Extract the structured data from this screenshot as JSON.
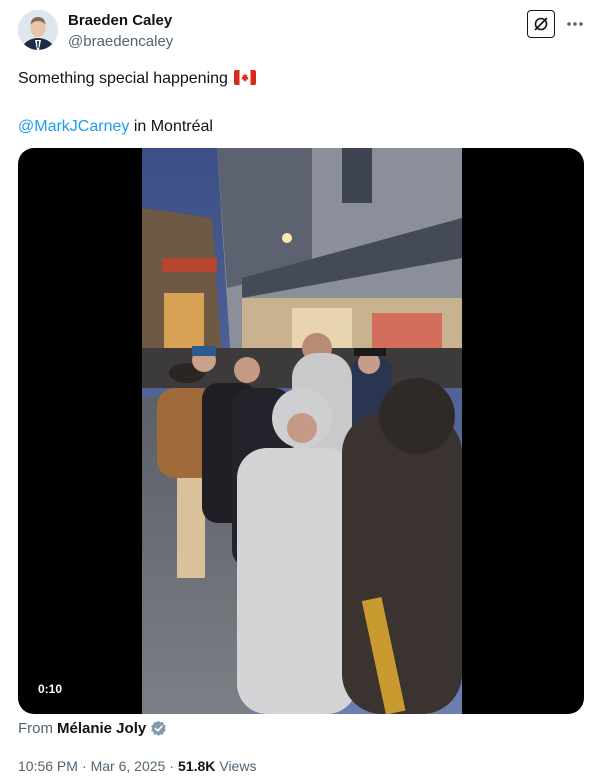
{
  "author": {
    "name": "Braeden Caley",
    "handle": "@braedencaley"
  },
  "tweet": {
    "line1": "Something special happening",
    "flag_icon": "canada-flag-emoji",
    "mention": "@MarkJCarney",
    "line2_rest": " in Montréal"
  },
  "media": {
    "duration": "0:10"
  },
  "source": {
    "prefix": "From",
    "name": "Mélanie Joly"
  },
  "meta": {
    "time": "10:56 PM",
    "separator1": "·",
    "date": "Mar 6, 2025",
    "separator2": "·",
    "views_count": "51.8K",
    "views_label": "Views"
  },
  "colors": {
    "link": "#1d9bf0",
    "secondary_text": "#536471",
    "verified_badge": "#829aab"
  }
}
